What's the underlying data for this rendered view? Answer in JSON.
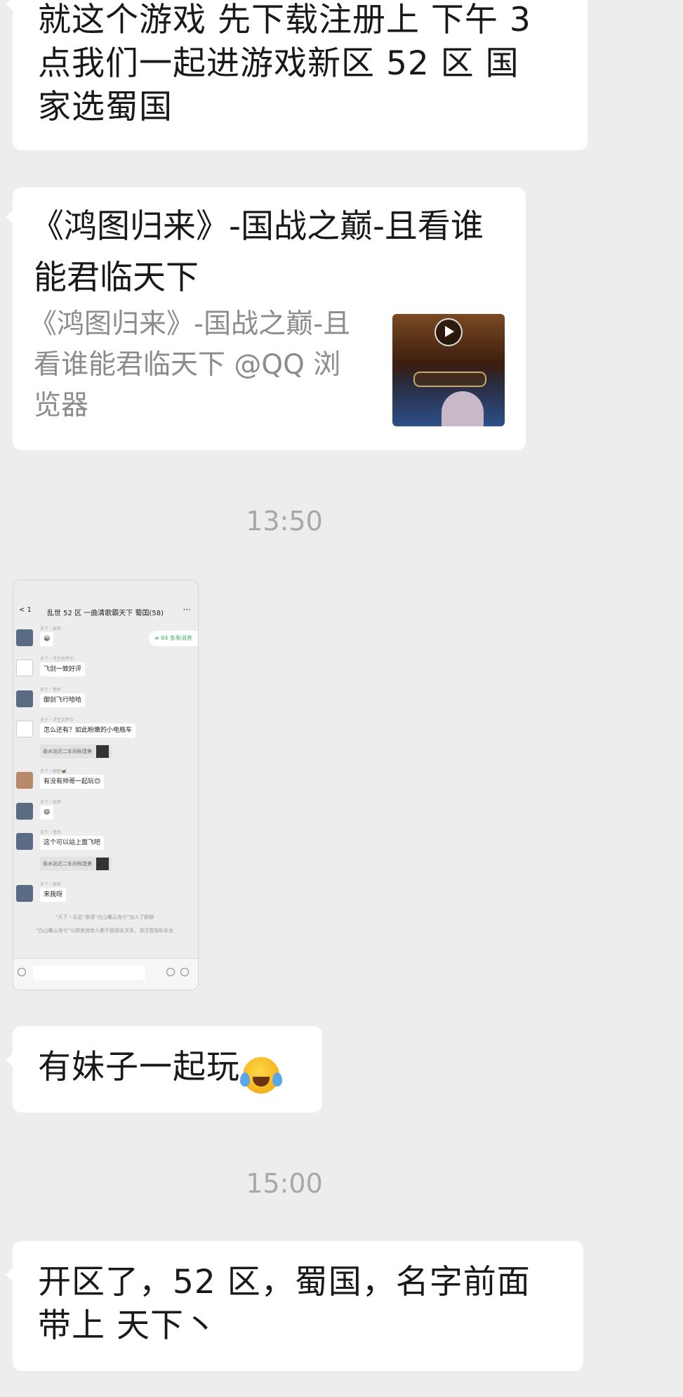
{
  "messages": [
    {
      "lines": [
        "就这个游戏  先下载注册上  下午 3",
        "点我们一起进游戏新区 52 区   国",
        "家选蜀国"
      ]
    },
    {
      "link_card": {
        "title_lines": [
          "《鸿图归来》-国战之巅-且看谁",
          "能君临天下"
        ],
        "desc_lines": [
          "《鸿图归来》-国战之巅-且",
          "看谁能君临天下 @QQ 浏",
          "览器"
        ],
        "thumb_icon": "video-play-icon"
      }
    },
    {
      "timestamp": "13:50"
    },
    {
      "image": {
        "header_back": "< 1",
        "header_title": "乱世 52 区 一曲清歌霸天下 蜀国(58)",
        "header_more": "···",
        "new_msgs": "≡ 84 条新消息",
        "rows": [
          {
            "name": "天下丶柴雨",
            "msg": "😀"
          },
          {
            "name": "天下丶浮生若梦中",
            "msg": "飞剑一致好评"
          },
          {
            "name": "天下丶借世",
            "msg": "御剑飞行哈哈"
          },
          {
            "name": "天下丶浮生若梦中",
            "msg": "怎么还有？如此粉嫩的小电瓶车"
          },
          {
            "name": "天下丶妮妮🦋",
            "msg": "有没有帅哥一起玩😊"
          },
          {
            "name": "天下丶柴雨",
            "msg": "😄"
          },
          {
            "name": "天下丶借世",
            "msg": "这个可以站上面飞吧"
          },
          {
            "name": "天下丶柴雨",
            "msg": "来我呀"
          }
        ],
        "quote": "香水站近二车间秋建美",
        "sys1": "“天下丶无鼠”邀请“白山曦云逸兮”加入了群聊",
        "sys2": "“白山曦云逸兮”与群里其他人都不是朋友关系，请注意隐私安全"
      }
    },
    {
      "text_with_emoji": {
        "text": "有妹子一起玩",
        "emoji": "loudly-crying-laughing-emoji"
      }
    },
    {
      "timestamp": "15:00"
    },
    {
      "lines": [
        " 开区了，52 区，蜀国，名字前面",
        "带上 天下丶"
      ]
    }
  ]
}
